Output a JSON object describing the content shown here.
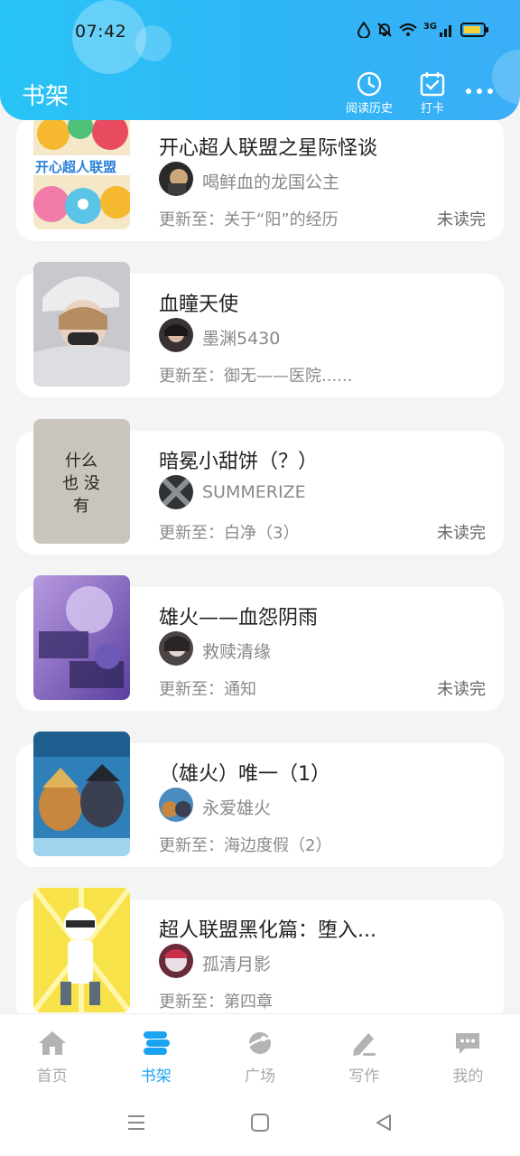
{
  "status_bar": {
    "time": "07:42",
    "network": "3G"
  },
  "header": {
    "title": "书架",
    "history_label": "阅读历史",
    "checkin_label": "打卡"
  },
  "books": [
    {
      "title": "开心超人联盟之星际怪谈",
      "author": "喝鲜血的龙国公主",
      "update": "更新至：关于“阳”的经历",
      "status": "未读完"
    },
    {
      "title": "血瞳天使",
      "author": "墨渊5430",
      "update": "更新至：御无——医院......",
      "status": ""
    },
    {
      "title": "暗冕小甜饼（？）",
      "author": "SUMMERIZE",
      "update": "更新至：白净（3）",
      "status": "未读完"
    },
    {
      "title": "雄火——血怨阴雨",
      "author": "救赎清缘",
      "update": "更新至：通知",
      "status": "未读完"
    },
    {
      "title": "（雄火）唯一（1）",
      "author": "永爱雄火",
      "update": "更新至：海边度假（2）",
      "status": ""
    },
    {
      "title": "超人联盟黑化篇：堕入...",
      "author": "孤清月影",
      "update": "更新至：第四章",
      "status": ""
    }
  ],
  "cover_texts": {
    "book1": "开心超人联盟",
    "book3": "什么 也 没有"
  },
  "bottom_nav": {
    "home": "首页",
    "shelf": "书架",
    "square": "广场",
    "write": "写作",
    "mine": "我的"
  },
  "colors": {
    "accent": "#1aa3f0",
    "header": "#2fb5f5"
  }
}
